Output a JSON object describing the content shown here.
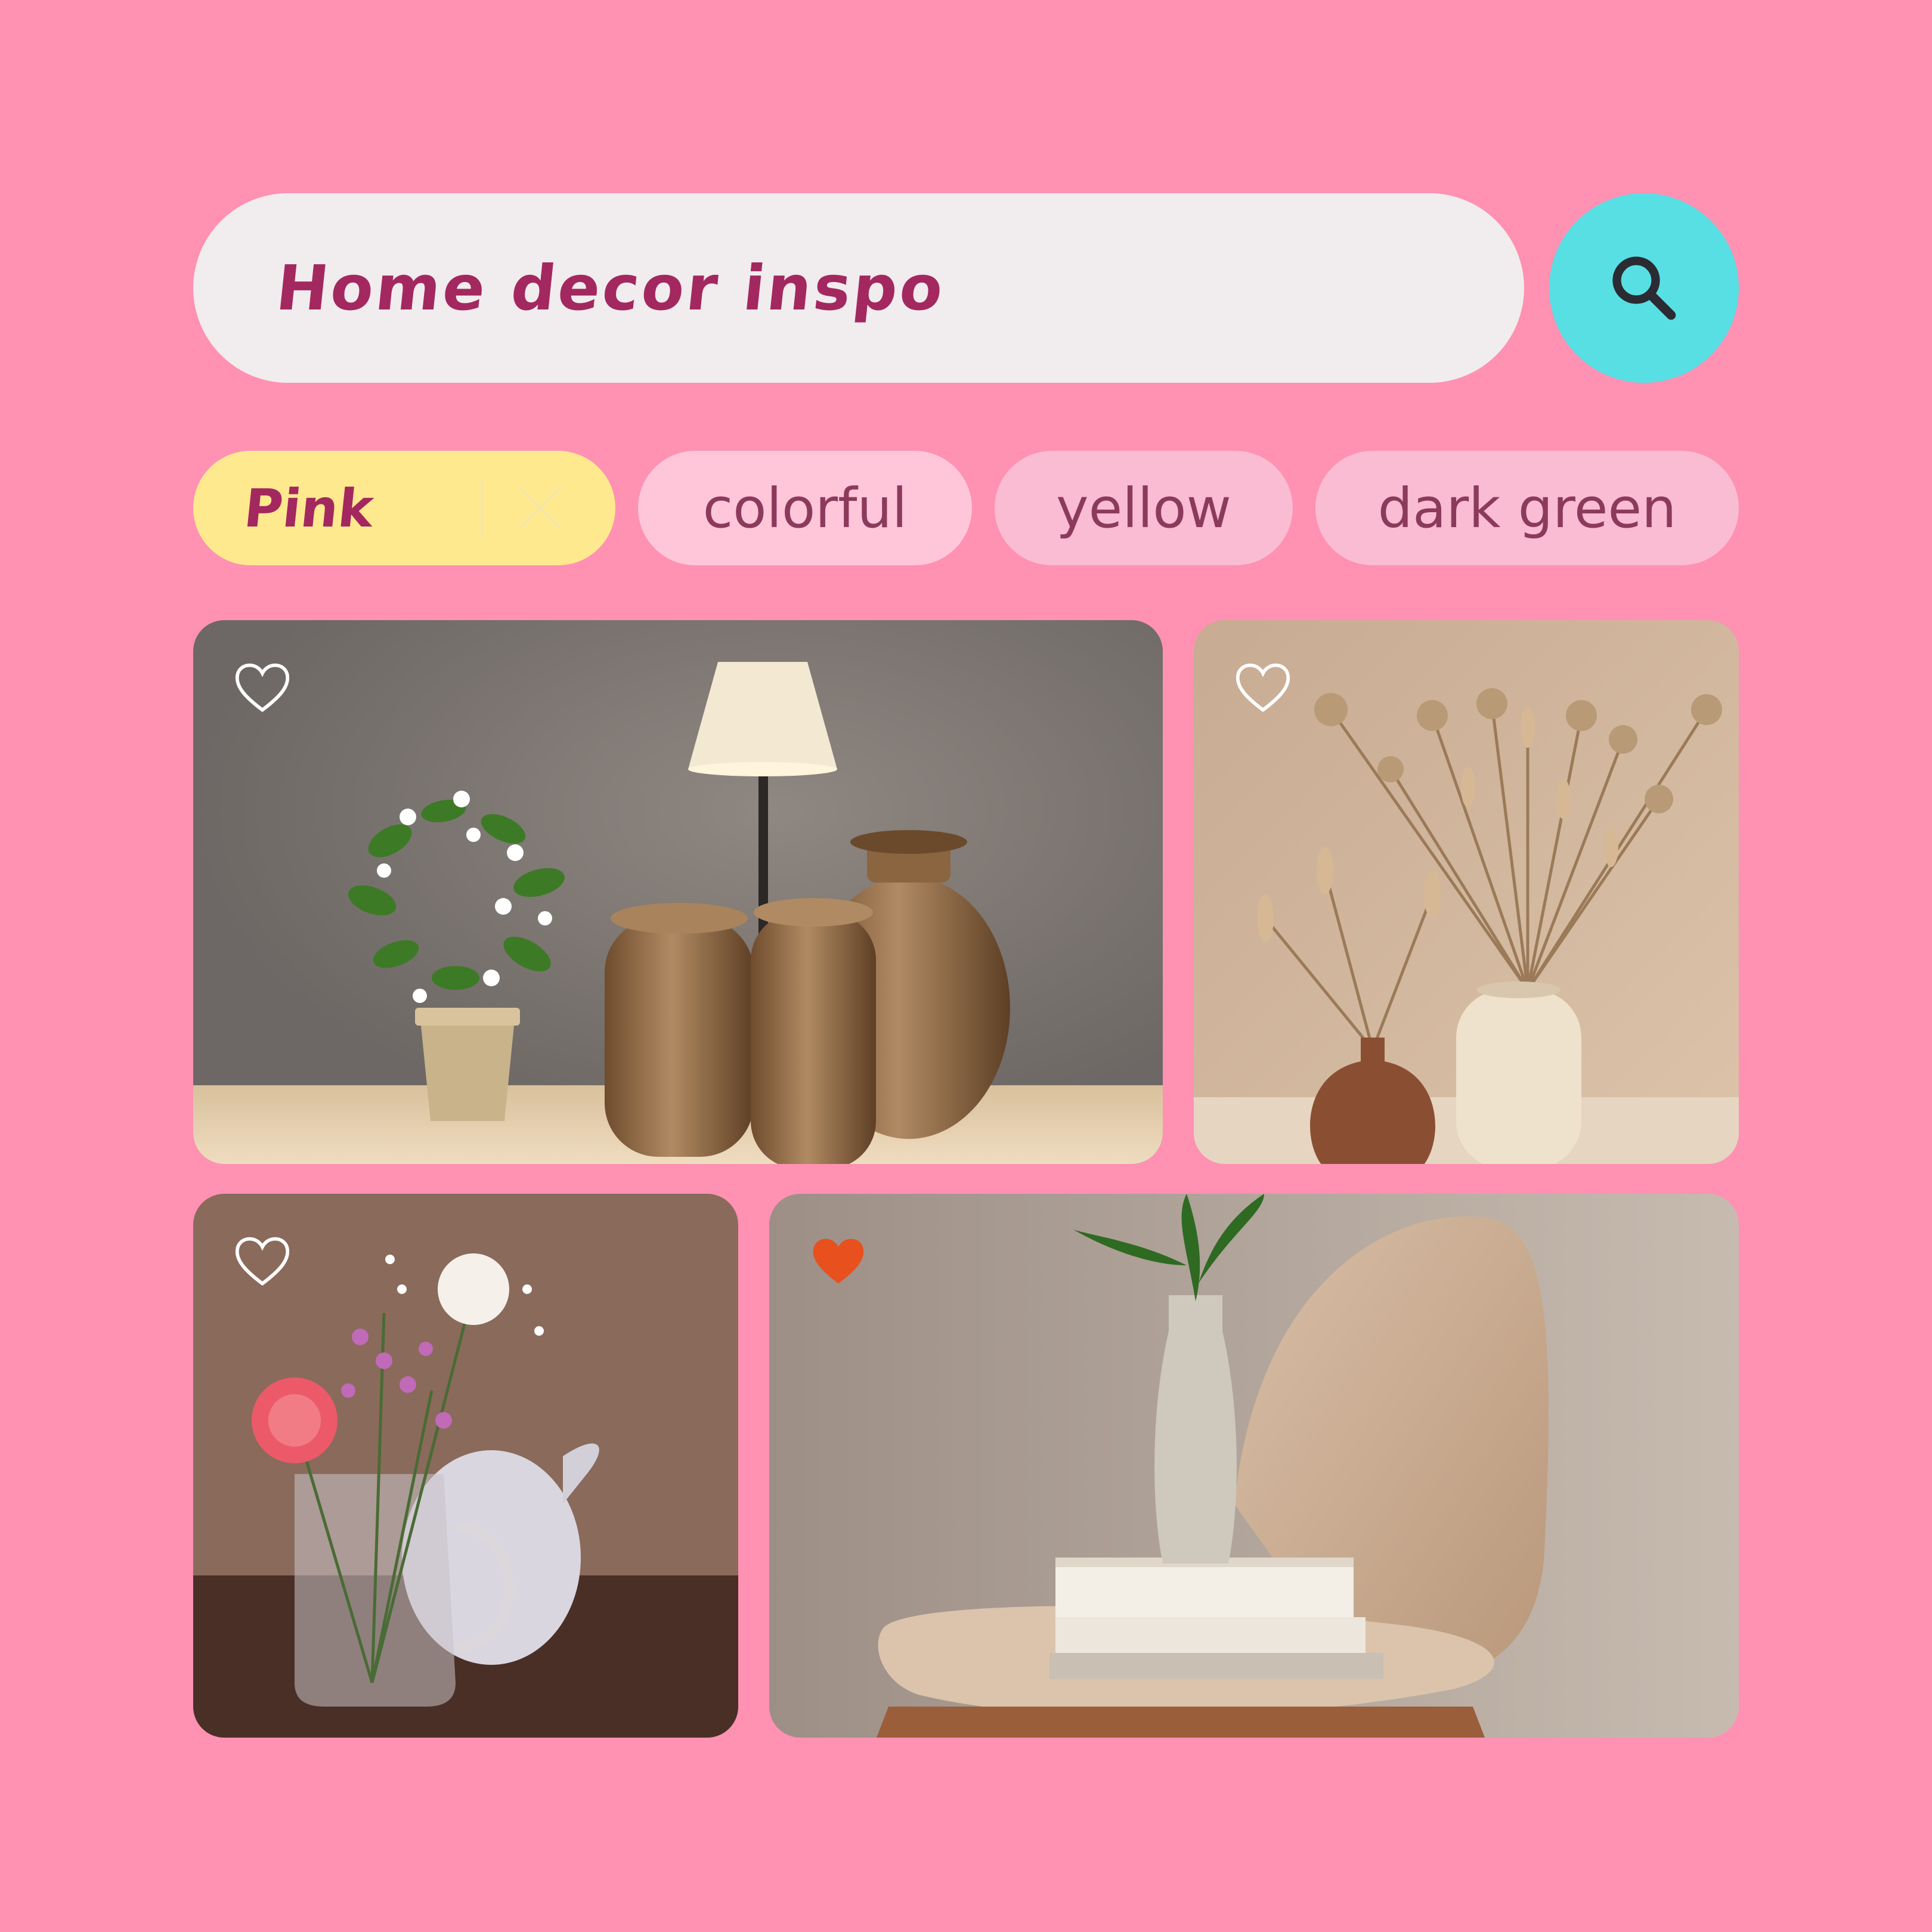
{
  "search": {
    "query": "Home decor inspo",
    "icon": "search-icon"
  },
  "filters": {
    "active": {
      "label": "Pink",
      "remove_icon": "close-icon"
    },
    "suggestions": [
      {
        "label": "colorful"
      },
      {
        "label": "yellow"
      },
      {
        "label": "dark green"
      }
    ]
  },
  "results": [
    {
      "subject": "wooden vases with table lamp and flowering plant",
      "favorited": false
    },
    {
      "subject": "dried flowers in ceramic vases",
      "favorited": false
    },
    {
      "subject": "fresh flowers in glass pitcher",
      "favorited": false
    },
    {
      "subject": "vase on books on a wooden chair",
      "favorited": true
    }
  ],
  "colors": {
    "background": "#ff91b3",
    "search_field": "#f1ecee",
    "search_button": "#58dfe4",
    "active_chip": "#ffe98f",
    "chip": "#f9bcd3",
    "accent_text": "#a3285f",
    "chip_text": "#8c3a5b",
    "favorite_heart": "#e8501e"
  }
}
